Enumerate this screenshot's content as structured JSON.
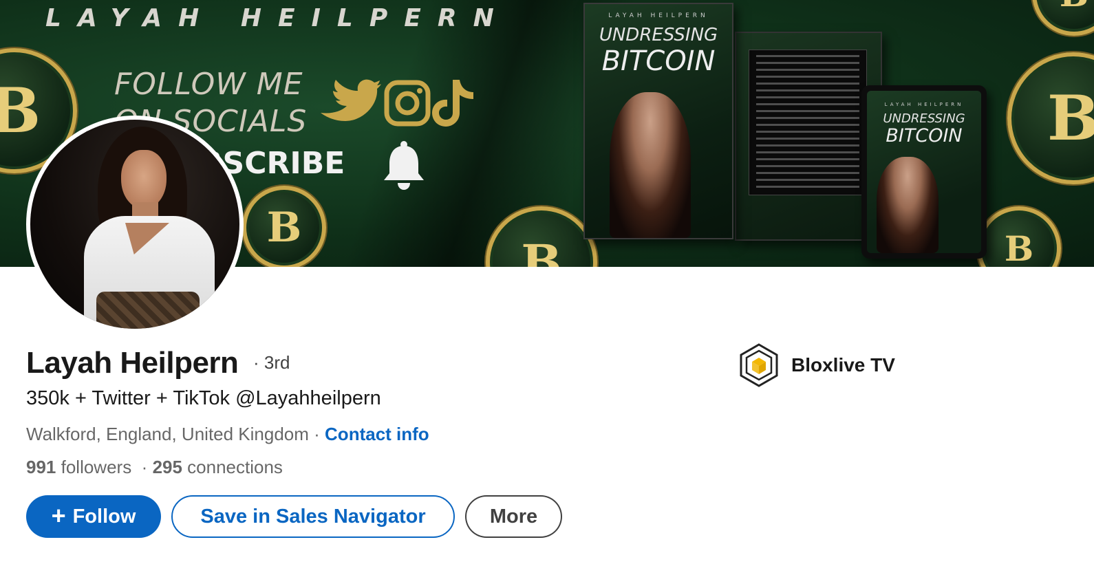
{
  "banner": {
    "brand_text": "LAYAH HEILPERN",
    "follow_line_1": "FOLLOW ME",
    "follow_line_2": "ON SOCIALS",
    "subscribe_text": "BSCRIBE",
    "book_author": "LAYAH HEILPERN",
    "book_title_1": "UNDRESSING",
    "book_title_2": "BITCOIN",
    "coin_letter": "B",
    "icons": [
      "twitter-icon",
      "instagram-icon",
      "tiktok-icon",
      "bell-icon"
    ],
    "colors": {
      "background": "#0f3019",
      "gold": "#c9a74b"
    }
  },
  "profile": {
    "name": "Layah Heilpern",
    "degree": "· 3rd",
    "headline": "350k + Twitter + TikTok @Layahheilpern",
    "location": "Walkford, England, United Kingdom",
    "location_separator": " · ",
    "contact_info_label": "Contact info",
    "followers_count": "991",
    "followers_label": " followers",
    "stats_separator": "  · ",
    "connections_count": "295",
    "connections_label": " connections"
  },
  "actions": {
    "follow_icon": "+",
    "follow_label": "Follow",
    "save_sales_navigator_label": "Save in Sales Navigator",
    "more_label": "More"
  },
  "company": {
    "name": "Bloxlive TV",
    "logo_icon": "cube-logo-icon"
  },
  "theme": {
    "primary": "#0a66c2",
    "text_primary": "#000000e6",
    "text_secondary": "#00000099"
  }
}
